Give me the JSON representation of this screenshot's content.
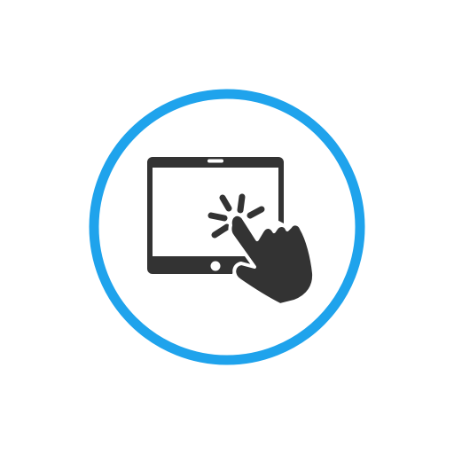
{
  "icon": {
    "name": "tablet-touch-icon",
    "depicts": [
      "circle-ring",
      "tablet",
      "home-button",
      "pointing-hand",
      "tap-burst"
    ]
  },
  "colors": {
    "background": "#ffffff",
    "ring": "#1fa3ec",
    "glyph": "#333333"
  }
}
